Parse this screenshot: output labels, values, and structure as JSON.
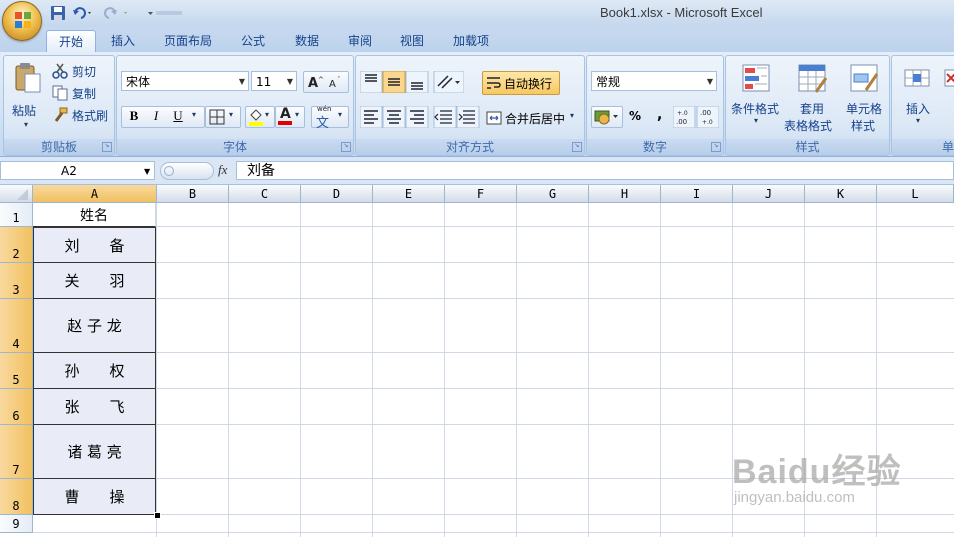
{
  "window": {
    "title": "Book1.xlsx - Microsoft Excel"
  },
  "tabs": [
    {
      "label": "开始",
      "active": true
    },
    {
      "label": "插入"
    },
    {
      "label": "页面布局"
    },
    {
      "label": "公式"
    },
    {
      "label": "数据"
    },
    {
      "label": "审阅"
    },
    {
      "label": "视图"
    },
    {
      "label": "加载项"
    }
  ],
  "ribbon": {
    "clipboard": {
      "label": "剪贴板",
      "paste": "粘贴",
      "cut": "剪切",
      "copy": "复制",
      "format_painter": "格式刷"
    },
    "font": {
      "label": "字体",
      "name": "宋体",
      "size": "11",
      "bold": "B",
      "italic": "I",
      "underline": "U",
      "font_color": "A",
      "phonetic": "wén"
    },
    "alignment": {
      "label": "对齐方式",
      "wrap_text": "自动换行",
      "merge_center": "合并后居中"
    },
    "number": {
      "label": "数字",
      "format": "常规",
      "percent": "%",
      "comma": ","
    },
    "styles": {
      "label": "样式",
      "conditional": "条件格式",
      "table_1": "套用",
      "table_2": "表格格式",
      "cell_1": "单元格",
      "cell_2": "样式"
    },
    "cells": {
      "label": "单",
      "insert": "插入"
    }
  },
  "formula_bar": {
    "name_box": "A2",
    "fx": "fx",
    "content": "刘备"
  },
  "grid": {
    "columns": [
      "A",
      "B",
      "C",
      "D",
      "E",
      "F",
      "G",
      "H",
      "I",
      "J",
      "K",
      "L"
    ],
    "rows": [
      "1",
      "2",
      "3",
      "4",
      "5",
      "6",
      "7",
      "8",
      "9"
    ],
    "a_cells": [
      "姓名",
      "刘　　备",
      "关　　羽",
      "赵 子 龙",
      "孙　　权",
      "张　　飞",
      "诸 葛 亮",
      "曹　　操"
    ]
  },
  "watermark": {
    "brand": "Baidu经验",
    "url": "jingyan.baidu.com"
  },
  "colors": {
    "accent": "#f1c15f",
    "ribbon_text": "#15428b",
    "selection_fill": "#e9ecf6"
  }
}
